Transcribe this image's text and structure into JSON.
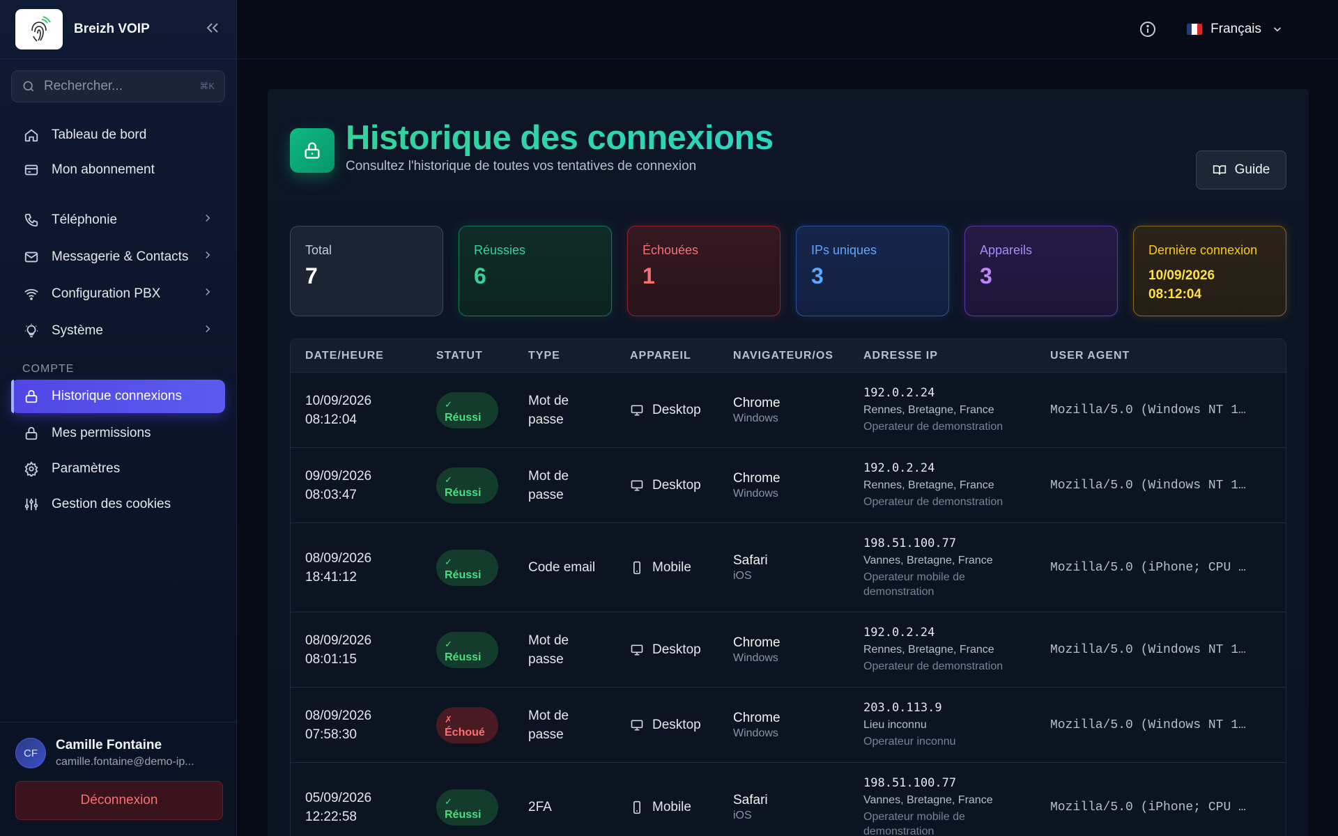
{
  "app": {
    "name": "Breizh VOIP"
  },
  "search": {
    "placeholder": "Rechercher...",
    "shortcut": "⌘K"
  },
  "nav": {
    "top": [
      {
        "label": "Tableau de bord",
        "icon": "home-icon"
      },
      {
        "label": "Mon abonnement",
        "icon": "credit-card-icon"
      }
    ],
    "groups": [
      {
        "label": "Téléphonie",
        "icon": "phone-icon"
      },
      {
        "label": "Messagerie & Contacts",
        "icon": "mail-icon"
      },
      {
        "label": "Configuration PBX",
        "icon": "wifi-icon"
      },
      {
        "label": "Système",
        "icon": "lightbulb-icon"
      }
    ],
    "account_section": "COMPTE",
    "account": [
      {
        "label": "Historique connexions",
        "icon": "lock-icon",
        "active": true
      },
      {
        "label": "Mes permissions",
        "icon": "lock-icon"
      },
      {
        "label": "Paramètres",
        "icon": "gear-icon"
      },
      {
        "label": "Gestion des cookies",
        "icon": "sliders-icon"
      }
    ]
  },
  "user": {
    "initials": "CF",
    "name": "Camille Fontaine",
    "email": "camille.fontaine@demo-ip...",
    "logout_label": "Déconnexion"
  },
  "topbar": {
    "language": "Français"
  },
  "page": {
    "title": "Historique des connexions",
    "subtitle": "Consultez l'historique de toutes vos tentatives de connexion",
    "guide_label": "Guide"
  },
  "stats": {
    "total": {
      "label": "Total",
      "value": "7"
    },
    "success": {
      "label": "Réussies",
      "value": "6"
    },
    "failed": {
      "label": "Échouées",
      "value": "1"
    },
    "ips": {
      "label": "IPs uniques",
      "value": "3"
    },
    "devices": {
      "label": "Appareils",
      "value": "3"
    },
    "last": {
      "label": "Dernière connexion",
      "date": "10/09/2026",
      "time": "08:12:04"
    }
  },
  "table": {
    "headers": [
      "DATE/HEURE",
      "STATUT",
      "TYPE",
      "APPAREIL",
      "NAVIGATEUR/OS",
      "ADRESSE IP",
      "USER AGENT"
    ],
    "rows": [
      {
        "date": "10/09/2026",
        "time": "08:12:04",
        "status_mark": "✓",
        "status": "Réussi",
        "ok": true,
        "type": "Mot de passe",
        "device": "Desktop",
        "browser": "Chrome",
        "os": "Windows",
        "ip": "192.0.2.24",
        "location": "Rennes, Bretagne, France",
        "isp": "Operateur de demonstration",
        "ua": "Mozilla/5.0 (Windows NT 1…"
      },
      {
        "date": "09/09/2026",
        "time": "08:03:47",
        "status_mark": "✓",
        "status": "Réussi",
        "ok": true,
        "type": "Mot de passe",
        "device": "Desktop",
        "browser": "Chrome",
        "os": "Windows",
        "ip": "192.0.2.24",
        "location": "Rennes, Bretagne, France",
        "isp": "Operateur de demonstration",
        "ua": "Mozilla/5.0 (Windows NT 1…"
      },
      {
        "date": "08/09/2026",
        "time": "18:41:12",
        "status_mark": "✓",
        "status": "Réussi",
        "ok": true,
        "type": "Code email",
        "device": "Mobile",
        "browser": "Safari",
        "os": "iOS",
        "ip": "198.51.100.77",
        "location": "Vannes, Bretagne, France",
        "isp": "Operateur mobile de demonstration",
        "ua": "Mozilla/5.0 (iPhone; CPU …"
      },
      {
        "date": "08/09/2026",
        "time": "08:01:15",
        "status_mark": "✓",
        "status": "Réussi",
        "ok": true,
        "type": "Mot de passe",
        "device": "Desktop",
        "browser": "Chrome",
        "os": "Windows",
        "ip": "192.0.2.24",
        "location": "Rennes, Bretagne, France",
        "isp": "Operateur de demonstration",
        "ua": "Mozilla/5.0 (Windows NT 1…"
      },
      {
        "date": "08/09/2026",
        "time": "07:58:30",
        "status_mark": "✗",
        "status": "Échoué",
        "ok": false,
        "type": "Mot de passe",
        "device": "Desktop",
        "browser": "Chrome",
        "os": "Windows",
        "ip": "203.0.113.9",
        "location": "Lieu inconnu",
        "isp": "Operateur inconnu",
        "ua": "Mozilla/5.0 (Windows NT 1…"
      },
      {
        "date": "05/09/2026",
        "time": "12:22:58",
        "status_mark": "✓",
        "status": "Réussi",
        "ok": true,
        "type": "2FA",
        "device": "Mobile",
        "browser": "Safari",
        "os": "iOS",
        "ip": "198.51.100.77",
        "location": "Vannes, Bretagne, France",
        "isp": "Operateur mobile de demonstration",
        "ua": "Mozilla/5.0 (iPhone; CPU …"
      }
    ]
  }
}
